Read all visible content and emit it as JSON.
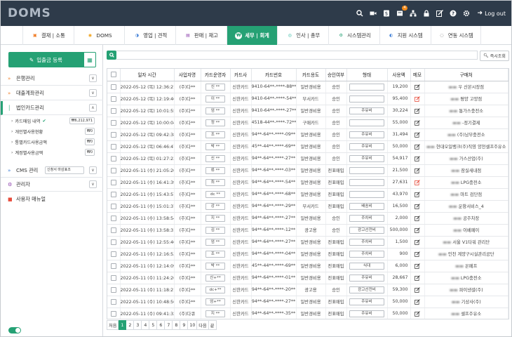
{
  "app": {
    "logo": "DOMS",
    "logout": "Log out",
    "notification_count": "4"
  },
  "menu": [
    {
      "label": "결재 | 소통",
      "icon": "doc-icon",
      "color": "#f07a22"
    },
    {
      "label": "DOMS",
      "icon": "doms-icon",
      "color": "#f0a21a"
    },
    {
      "label": "영업 | 견적",
      "icon": "chart-icon",
      "color": "#3a7bd5"
    },
    {
      "label": "판매 | 재고",
      "icon": "box-icon",
      "color": "#8e44ad"
    },
    {
      "label": "세무 | 회계",
      "icon": "won-icon",
      "color": "#ffffff"
    },
    {
      "label": "인사 | 총무",
      "icon": "person-icon",
      "color": "#2eb8a0"
    },
    {
      "label": "시스템관리",
      "icon": "gear-icon",
      "color": "#25a174"
    },
    {
      "label": "지원 시스템",
      "icon": "support-icon",
      "color": "#3a7bd5"
    },
    {
      "label": "연동 시스템",
      "icon": "link-icon",
      "color": "#555555"
    }
  ],
  "sidebar": {
    "register_label": "입출금 등록",
    "groups": {
      "bank": "은행관리",
      "loan": "대출계좌관리",
      "card": "법인카드관리",
      "cms": "CMS 관리",
      "admin": "관리자",
      "manual": "사용자 매뉴얼"
    },
    "card_items": [
      {
        "label": "카드매입 내역",
        "amount": "₩6,212,971"
      },
      {
        "label": "개인별사용현황",
        "amount": "₩0"
      },
      {
        "label": "통별카드사용금액",
        "amount": "₩0"
      },
      {
        "label": "계정별사용금액",
        "amount": "₩0"
      }
    ],
    "cms_select": "신청서 마감표조"
  },
  "main": {
    "quick_label": "즉시조회",
    "columns": [
      "",
      "일자 시간",
      "사업자명",
      "카드운영자",
      "카드사",
      "카드번호",
      "카드용도",
      "승인여부",
      "형태",
      "사용액",
      "메모",
      "구매처"
    ],
    "rows": [
      {
        "date": "2022-05-12 (목) 12:36:21",
        "biz": "(주)다**",
        "user": "신 **",
        "co": "신한카드",
        "num": "9410-64**-****-88**",
        "use": "일반경비용",
        "appr": "승인",
        "type": "",
        "amt": "19,200",
        "vendor": "우 산본시장점"
      },
      {
        "date": "2022-05-12 (목) 12:19:40",
        "biz": "(주)다**",
        "user": "이 **",
        "co": "신한카드",
        "num": "9410-64**-****-54**",
        "use": "부서카드",
        "appr": "승인",
        "type": "",
        "amt": "95,400",
        "vendor": "평양 고양점"
      },
      {
        "date": "2022-05-12 (목) 10:01:55",
        "biz": "(주)다**",
        "user": "엄 **",
        "co": "신한카드",
        "num": "9410-64**-****-27**",
        "use": "일반경비용",
        "appr": "승인",
        "type": "주유비",
        "amt": "30,224",
        "vendor": "통가스충전소"
      },
      {
        "date": "2022-05-12 (목) 10:00:04",
        "biz": "(주)다**",
        "user": "정 **",
        "co": "신한카드",
        "num": "4518-44**-****-72**",
        "use": "구매카드",
        "appr": "승인",
        "type": "",
        "amt": "55,000",
        "vendor": "-정기결제"
      },
      {
        "date": "2022-05-12 (목) 09:42:38",
        "biz": "(주)다**",
        "user": "조 **",
        "co": "신한카드",
        "num": "94**-64**-****-09**",
        "use": "일반경비용",
        "appr": "승인",
        "type": "주유비",
        "amt": "31,494",
        "vendor": "(주)남부충전소"
      },
      {
        "date": "2022-05-12 (목) 06:46:47",
        "biz": "(주)다**",
        "user": "박 **",
        "co": "신한카드",
        "num": "45**-44**-****-69**",
        "use": "일반경비용",
        "appr": "승인",
        "type": "주유비",
        "amt": "50,000",
        "vendor": "현대오일뱅크(주)직영 양천셀프주유소"
      },
      {
        "date": "2022-05-12 (목) 01:27:23",
        "biz": "(주)다**",
        "user": "신 **",
        "co": "신한카드",
        "num": "94**-64**-****-27**",
        "use": "일반경비용",
        "appr": "승인",
        "type": "주유비",
        "amt": "54,917",
        "vendor": "가스산업(주)"
      },
      {
        "date": "2022-05-11 (수) 21:05:20",
        "biz": "(주)다**",
        "user": "류 **",
        "co": "신한카드",
        "num": "94**-64**-****-03**",
        "use": "일반경비용",
        "appr": "전표매입",
        "type": "",
        "amt": "21,500",
        "vendor": "잠실새내점"
      },
      {
        "date": "2022-05-11 (수) 16:41:39",
        "biz": "(주)다**",
        "user": "최 **",
        "co": "신한카드",
        "num": "94**-64**-****-54**",
        "use": "일반경비용",
        "appr": "전표매입",
        "type": "",
        "amt": "27,631",
        "vendor": "LPG충전소"
      },
      {
        "date": "2022-05-11 (수) 15:43:57",
        "biz": "(주)다**",
        "user": "dc **",
        "co": "신한카드",
        "num": "94**-64**-****-68**",
        "use": "일반경비용",
        "appr": "전표매입",
        "type": "",
        "amt": "43,970",
        "vendor": "마트 검단점"
      },
      {
        "date": "2022-05-11 (수) 15:01:37",
        "biz": "(주)다**",
        "user": "강 **",
        "co": "신한카드",
        "num": "94**-64**-****-29**",
        "use": "부서카드",
        "appr": "전표매입",
        "type": "배송비",
        "amt": "16,500",
        "vendor": "운항서비스_4"
      },
      {
        "date": "2022-05-11 (수) 13:58:54",
        "biz": "(주)다**",
        "user": "지 **",
        "co": "신한카드",
        "num": "94**-64**-****-27**",
        "use": "일반경비용",
        "appr": "승인",
        "type": "주차비",
        "amt": "2,000",
        "vendor": "공주차장"
      },
      {
        "date": "2022-05-11 (수) 13:58:31",
        "biz": "(주)다**",
        "user": "김 **",
        "co": "신한카드",
        "num": "94**-64**-****-12**",
        "use": "광고용",
        "appr": "승인",
        "type": "광고선전비",
        "amt": "500,000",
        "vendor": "이베페이"
      },
      {
        "date": "2022-05-11 (수) 12:55:40",
        "biz": "(주)다**",
        "user": "엄 **",
        "co": "신한카드",
        "num": "94**-64**-****-27**",
        "use": "일반경비용",
        "appr": "전표매입",
        "type": "주차비",
        "amt": "1,500",
        "vendor": "서울 V1타워 관리단"
      },
      {
        "date": "2022-05-11 (수) 12:16:53",
        "biz": "(주)다**",
        "user": "조 **",
        "co": "신한카드",
        "num": "94**-64**-****-04**",
        "use": "일반경비용",
        "appr": "전표매입",
        "type": "주차비",
        "amt": "900",
        "vendor": "인천 계양구시설관리공단"
      },
      {
        "date": "2022-05-11 (수) 12:14:09",
        "biz": "(주)다**",
        "user": "박 **",
        "co": "신한카드",
        "num": "45**-44**-****-69**",
        "use": "일반경비용",
        "appr": "전표매입",
        "type": "식대",
        "amt": "6,000",
        "vendor": "온페프"
      },
      {
        "date": "2022-05-11 (수) 11:24:26",
        "biz": "(주)다**",
        "user": "신+**",
        "co": "신한카드",
        "num": "94**-64**-****-01**",
        "use": "일반경비용",
        "appr": "전표매입",
        "type": "주유비",
        "amt": "28,667",
        "vendor": "LPG충전소"
      },
      {
        "date": "2022-05-11 (수) 11:18:21",
        "biz": "(주)다**",
        "user": "dc+**",
        "co": "신한카드",
        "num": "94**-64**-****-20**",
        "use": "광고용",
        "appr": "승인",
        "type": "광고선전비",
        "amt": "59,300",
        "vendor": "파이낸셜(주)"
      },
      {
        "date": "2022-05-11 (수) 10:48:56",
        "biz": "(주)다**",
        "user": "엄+**",
        "co": "신한카드",
        "num": "94**-64**-****-27**",
        "use": "일반경비용",
        "appr": "전표매입",
        "type": "주유비",
        "amt": "50,000",
        "vendor": "기상사(주)"
      },
      {
        "date": "2022-05-11 (수) 09:41:32",
        "biz": "(주)다큐",
        "user": "지 **",
        "co": "신한카드",
        "num": "94**-64**-****-35**",
        "use": "일반경비용",
        "appr": "전표매입",
        "type": "주유비",
        "amt": "50,000",
        "vendor": "셀프주유소"
      }
    ]
  },
  "pager": {
    "first": "처음",
    "pages": [
      "1",
      "2",
      "3",
      "4",
      "5",
      "6",
      "7",
      "8",
      "9",
      "10"
    ],
    "next": "다음",
    "last": "끝",
    "active": "1"
  },
  "colors": {
    "accent": "#25a174",
    "topbar": "#2e3b4a",
    "orange": "#f07a22",
    "memo_red": "#e74c3c"
  }
}
